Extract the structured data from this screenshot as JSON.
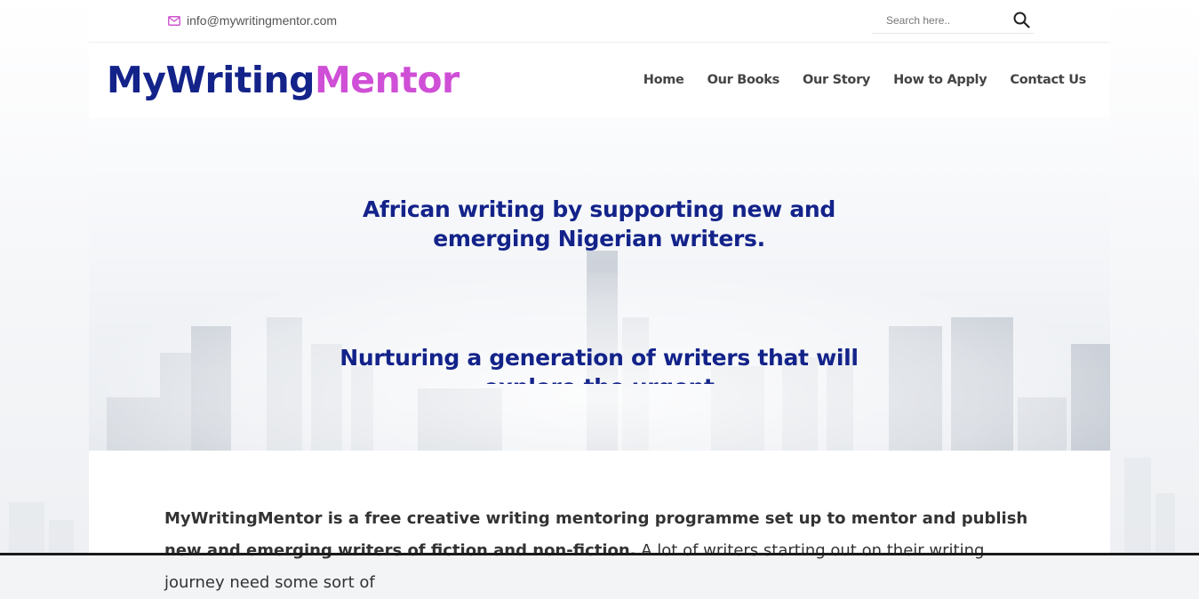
{
  "topbar": {
    "email": "info@mywritingmentor.com",
    "search_placeholder": "Search here.."
  },
  "logo": {
    "part1": "MyWriting",
    "part2": "Mentor"
  },
  "nav": [
    {
      "label": "Home"
    },
    {
      "label": "Our Books"
    },
    {
      "label": "Our Story"
    },
    {
      "label": "How to Apply"
    },
    {
      "label": "Contact Us"
    }
  ],
  "hero": {
    "headline_1": "African writing by supporting new and emerging Nigerian writers.",
    "headline_2": "Nurturing a generation of writers that will explore the urgent"
  },
  "intro": {
    "bold": "MyWritingMentor is a free creative writing mentoring programme set up to mentor and publish new and emerging writers of fiction and non-fiction.",
    "rest": " A lot of writers starting out on their writing journey need some sort of"
  },
  "colors": {
    "brand_blue": "#13238a",
    "brand_pink": "#cf4fd6",
    "mail_icon": "#d153cf"
  },
  "icons": [
    "envelope-icon",
    "search-icon"
  ]
}
